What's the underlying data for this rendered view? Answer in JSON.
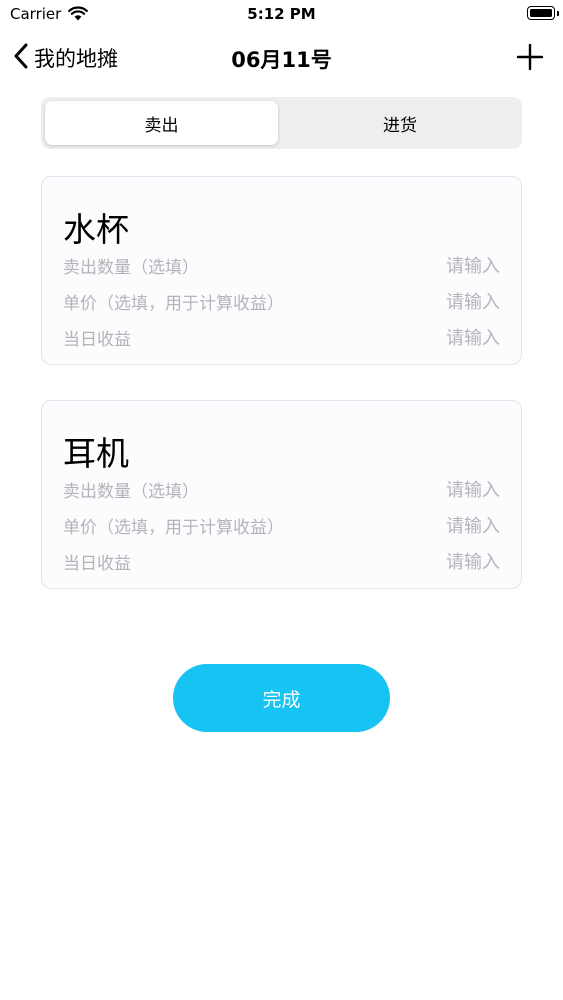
{
  "status_bar": {
    "carrier": "Carrier",
    "time": "5:12 PM"
  },
  "nav": {
    "back_label": "我的地摊",
    "title": "06月11号"
  },
  "segments": [
    {
      "label": "卖出",
      "selected": true
    },
    {
      "label": "进货",
      "selected": false
    }
  ],
  "items": [
    {
      "name": "水杯",
      "fields": [
        {
          "label": "卖出数量（选填）",
          "placeholder": "请输入",
          "value": ""
        },
        {
          "label": "单价（选填，用于计算收益）",
          "placeholder": "请输入",
          "value": ""
        },
        {
          "label": "当日收益",
          "placeholder": "请输入",
          "value": ""
        }
      ]
    },
    {
      "name": "耳机",
      "fields": [
        {
          "label": "卖出数量（选填）",
          "placeholder": "请输入",
          "value": ""
        },
        {
          "label": "单价（选填，用于计算收益）",
          "placeholder": "请输入",
          "value": ""
        },
        {
          "label": "当日收益",
          "placeholder": "请输入",
          "value": ""
        }
      ]
    }
  ],
  "done_button": {
    "label": "完成"
  },
  "colors": {
    "accent": "#16c3f2",
    "placeholder": "#b4b4b8",
    "card_bg": "#fcfbfd",
    "segment_bg": "#eeeef0"
  },
  "icons": {
    "back": "chevron-left-icon",
    "add": "plus-icon",
    "wifi": "wifi-icon",
    "battery": "battery-icon"
  }
}
